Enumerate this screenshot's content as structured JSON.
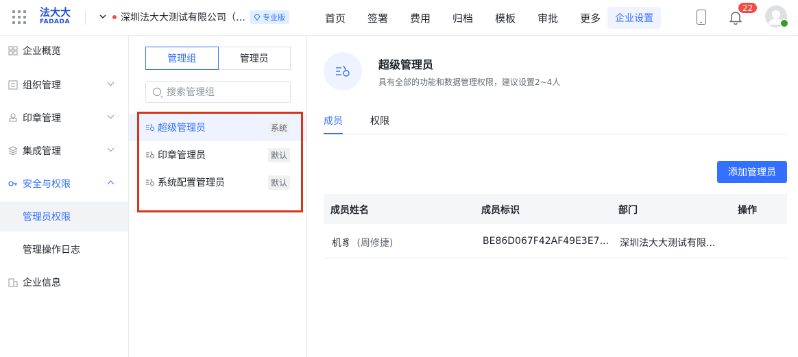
{
  "header": {
    "logo_top": "法大大",
    "logo_bottom": "FADADA",
    "company_name": "深圳法大大测试有限公司（…",
    "edition_badge": "专业版",
    "nav": [
      "首页",
      "签署",
      "费用",
      "归档",
      "模板",
      "审批",
      "更多",
      "企业设置"
    ],
    "active_nav": "企业设置",
    "notification_count": "22"
  },
  "sidebar": {
    "items": [
      {
        "label": "企业概览",
        "icon": "overview-icon"
      },
      {
        "label": "组织管理",
        "icon": "org-icon"
      },
      {
        "label": "印章管理",
        "icon": "seal-icon"
      },
      {
        "label": "集成管理",
        "icon": "layers-icon"
      },
      {
        "label": "安全与权限",
        "icon": "security-icon"
      },
      {
        "label": "管理员权限"
      },
      {
        "label": "管理操作日志"
      },
      {
        "label": "企业信息",
        "icon": "building-icon"
      }
    ]
  },
  "groups": {
    "segment_group": "管理组",
    "segment_admin": "管理员",
    "search_placeholder": "搜索管理组",
    "list": [
      {
        "label": "超级管理员",
        "tag": "系统"
      },
      {
        "label": "印章管理员",
        "tag": "默认"
      },
      {
        "label": "系统配置管理员",
        "tag": "默认"
      }
    ]
  },
  "detail": {
    "title": "超级管理员",
    "description": "具有全部的功能和数据管理权限，建议设置2~4人",
    "tabs": [
      "成员",
      "权限"
    ],
    "add_button": "添加管理员",
    "columns": [
      "成员姓名",
      "成员标识",
      "部门",
      "操作"
    ],
    "rows": [
      {
        "name": "机豸",
        "alias": "(周修捷)",
        "id": "BE86D067F42AF49E3E7...",
        "dept": "深圳法大大测试有限..."
      }
    ]
  },
  "colors": {
    "accent": "#3370ff",
    "highlight_box": "#d83417",
    "badge": "#f54a45"
  }
}
